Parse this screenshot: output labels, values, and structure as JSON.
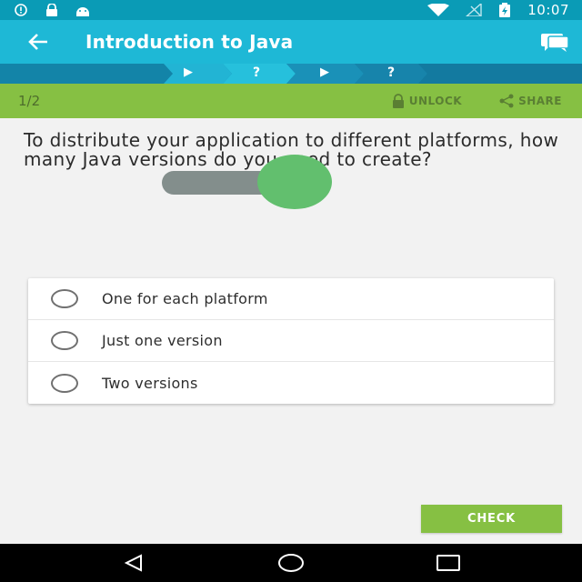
{
  "status_bar": {
    "time": "10:07",
    "icons": [
      "alert-icon",
      "lock-icon",
      "android-icon",
      "wifi-icon",
      "no-signal-icon",
      "battery-charging-icon"
    ]
  },
  "app_bar": {
    "title": "Introduction to Java",
    "back_icon": "arrow-left-icon",
    "comments_icon": "comments-icon",
    "color": "#1eb8d6"
  },
  "progress": {
    "steps": [
      {
        "symbol": "▶",
        "state": "done"
      },
      {
        "symbol": "?",
        "state": "current"
      },
      {
        "symbol": "▶",
        "state": "upcoming"
      },
      {
        "symbol": "?",
        "state": "upcoming"
      }
    ]
  },
  "lesson_bar": {
    "page_count": "1/2",
    "unlock_label": "UNLOCK",
    "share_label": "SHARE",
    "color": "#86c043"
  },
  "question": {
    "text": "To distribute your application to different platforms, how many Java versions do you need to create?"
  },
  "answers": [
    {
      "label": "One for each platform"
    },
    {
      "label": "Just one version"
    },
    {
      "label": "Two versions"
    }
  ],
  "check_button": {
    "label": "CHECK"
  },
  "nav_bar": {
    "icons": [
      "back-triangle-icon",
      "home-circle-icon",
      "recents-square-icon"
    ]
  }
}
